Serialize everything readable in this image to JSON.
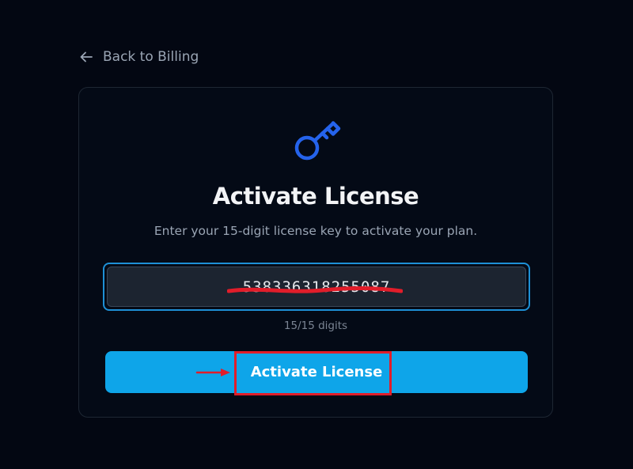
{
  "nav": {
    "back_label": "Back to Billing",
    "back_icon": "arrow-left-icon"
  },
  "card": {
    "icon": "key-icon",
    "title": "Activate License",
    "subtitle": "Enter your 15-digit license key to activate your plan.",
    "license_input": {
      "value": "538336318255087",
      "placeholder": ""
    },
    "digit_counter": "15/15 digits",
    "activate_label": "Activate License"
  },
  "annotations": {
    "highlight_color": "#e11d2a",
    "redaction_color": "#e11d2a"
  },
  "colors": {
    "background": "#030712",
    "card_border": "#1e2733",
    "accent": "#0ea5e9",
    "icon_blue": "#2563eb",
    "focus_ring": "#1e90d6"
  }
}
